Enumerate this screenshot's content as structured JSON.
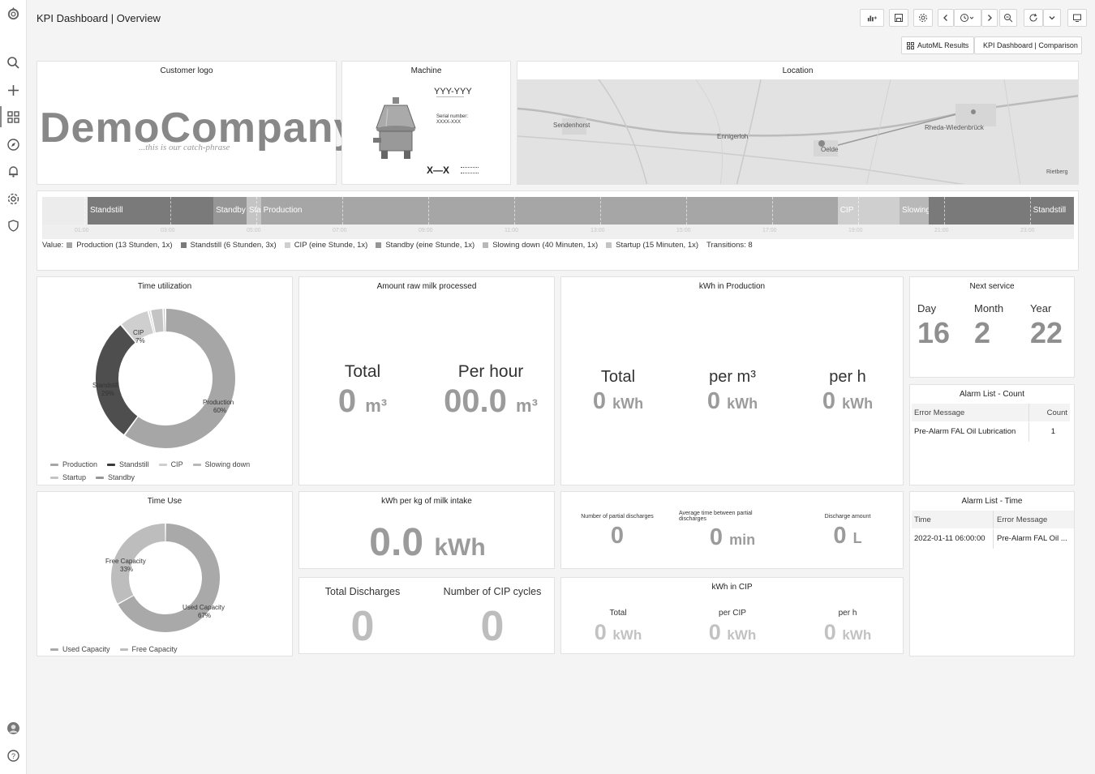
{
  "app": {
    "title": "KPI Dashboard | Overview",
    "links": [
      "AutoML Results",
      "KPI Dashboard | Comparison"
    ]
  },
  "sidebar": {
    "icons": [
      "grafana-logo-icon",
      "search-icon",
      "plus-icon",
      "dashboards-icon",
      "explore-icon",
      "bell-icon",
      "gear-icon",
      "shield-icon",
      "user-avatar-icon",
      "help-icon"
    ]
  },
  "toolbar": {
    "icons": [
      "add-panel-icon",
      "save-icon",
      "settings-icon",
      "chevron-left-icon",
      "clock-icon",
      "chevron-right-icon",
      "zoom-out-icon",
      "refresh-icon",
      "chevron-down-icon",
      "tv-icon"
    ]
  },
  "logo_panel": {
    "title": "Customer logo",
    "company": "DemoCompany",
    "tagline": "...this is our catch-phrase"
  },
  "machine_panel": {
    "title": "Machine",
    "model": "YYY-YYY",
    "serial_label": "Serial number:",
    "serial_value": "XXXX-XXX",
    "mark": "X—X"
  },
  "location_panel": {
    "title": "Location",
    "places": [
      "Sendenhorst",
      "Enniger­loh",
      "Oelde",
      "Rheda-Wiedenbrück",
      "Rietberg"
    ]
  },
  "state_timeline": {
    "segments": [
      {
        "label": "",
        "state": "none",
        "start": 0,
        "end": 0.044
      },
      {
        "label": "Standstill",
        "state": "Standstill",
        "start": 0.044,
        "end": 0.166
      },
      {
        "label": "Standby",
        "state": "Standby",
        "start": 0.166,
        "end": 0.198
      },
      {
        "label": "Sta",
        "state": "Startup",
        "start": 0.198,
        "end": 0.212
      },
      {
        "label": "Production",
        "state": "Production",
        "start": 0.212,
        "end": 0.771
      },
      {
        "label": "CIP",
        "state": "CIP",
        "start": 0.771,
        "end": 0.831
      },
      {
        "label": "Slowing",
        "state": "Slowing down",
        "start": 0.831,
        "end": 0.859
      },
      {
        "label": "",
        "state": "Standstill",
        "start": 0.859,
        "end": 0.958
      },
      {
        "label": "Standstill",
        "state": "Standstill",
        "start": 0.958,
        "end": 1.0
      }
    ],
    "ticks": [
      "01:00",
      "03:00",
      "05:00",
      "07:00",
      "09:00",
      "11:00",
      "13:00",
      "15:00",
      "17:00",
      "19:00",
      "21:00",
      "23:00"
    ],
    "value_prefix": "Value:",
    "legend": [
      "Production (13 Stunden, 1x)",
      "Standstill (6 Stunden, 3x)",
      "CIP (eine Stunde, 1x)",
      "Standby (eine Stunde, 1x)",
      "Slowing down (40 Minuten, 1x)",
      "Startup (15 Minuten, 1x)"
    ],
    "transitions": "Transitions: 8"
  },
  "colors": {
    "Production": "#a6a6a6",
    "Standstill": "#7a7a7a",
    "CIP": "#cfcfcf",
    "Standby": "#969696",
    "Startup": "#c4c4c4",
    "Slowing down": "#b8b8b8",
    "none": "#ececec",
    "Used Capacity": "#a9a9a9",
    "Free Capacity": "#bdbdbd"
  },
  "time_utilization": {
    "title": "Time utilization",
    "labels": [
      "CIP",
      "7%",
      "Standstill",
      "29%",
      "Production",
      "60%"
    ],
    "legend": [
      "Production",
      "Standstill",
      "CIP",
      "Slowing down",
      "Startup",
      "Standby"
    ],
    "chart_data": {
      "type": "pie",
      "categories": [
        "Production",
        "Standstill",
        "CIP",
        "Slowing down",
        "Startup",
        "Standby"
      ],
      "values": [
        60,
        29,
        7,
        0.5,
        3,
        0.5
      ]
    }
  },
  "milk_processed": {
    "title": "Amount raw milk processed",
    "total_label": "Total",
    "total_value": "0",
    "total_unit": "m³",
    "perhour_label": "Per hour",
    "perhour_value": "00.0",
    "perhour_unit": "m³"
  },
  "kwh_production": {
    "title": "kWh in Production",
    "items": [
      {
        "label": "Total",
        "value": "0",
        "unit": "kWh"
      },
      {
        "label": "per m³",
        "value": "0",
        "unit": "kWh"
      },
      {
        "label": "per h",
        "value": "0",
        "unit": "kWh"
      }
    ]
  },
  "next_service": {
    "title": "Next service",
    "day_label": "Day",
    "day_value": "16",
    "month_label": "Month",
    "month_value": "2",
    "year_label": "Year",
    "year_value": "22"
  },
  "alarm_count": {
    "title": "Alarm List - Count",
    "headers": [
      "Error Message",
      "Count"
    ],
    "rows": [
      [
        "Pre-Alarm FAL Oil Lubrication",
        "1"
      ]
    ]
  },
  "time_use": {
    "title": "Time Use",
    "labels": [
      "Free Capacity",
      "33%",
      "Used Capacity",
      "67%"
    ],
    "legend": [
      "Used Capacity",
      "Free Capacity"
    ],
    "chart_data": {
      "type": "pie",
      "categories": [
        "Used Capacity",
        "Free Capacity"
      ],
      "values": [
        67,
        33
      ]
    }
  },
  "kwh_per_kg": {
    "title": "kWh per kg of milk intake",
    "value": "0.0",
    "unit": "kWh"
  },
  "discharges": {
    "items": [
      {
        "label": "Number of partial discharges",
        "value": "0",
        "unit": ""
      },
      {
        "label": "Average time between partial discharges",
        "value": "0",
        "unit": "min"
      },
      {
        "label": "Discharge amount",
        "value": "0",
        "unit": "L"
      }
    ]
  },
  "alarm_time": {
    "title": "Alarm List - Time",
    "headers": [
      "Time",
      "Error Message"
    ],
    "rows": [
      [
        "2022-01-11 06:00:00",
        "Pre-Alarm FAL Oil ..."
      ]
    ]
  },
  "totals": {
    "discharges_label": "Total Discharges",
    "discharges_value": "0",
    "cip_label": "Number of CIP cycles",
    "cip_value": "0"
  },
  "kwh_cip": {
    "title": "kWh in CIP",
    "items": [
      {
        "label": "Total",
        "value": "0",
        "unit": "kWh"
      },
      {
        "label": "per CIP",
        "value": "0",
        "unit": "kWh"
      },
      {
        "label": "per h",
        "value": "0",
        "unit": "kWh"
      }
    ]
  }
}
